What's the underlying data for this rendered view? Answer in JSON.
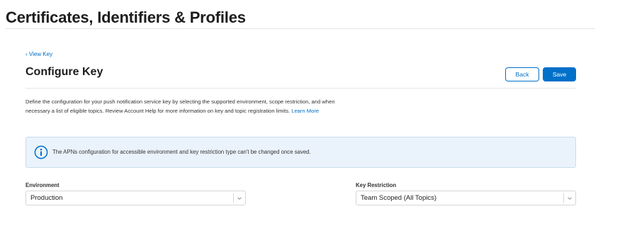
{
  "header": {
    "title": "Certificates, Identifiers & Profiles"
  },
  "nav": {
    "back_link": "‹ View Key"
  },
  "section": {
    "title": "Configure Key",
    "back_button": "Back",
    "save_button": "Save",
    "description": "Define the configuration for your push notification service key by selecting the supported environment, scope restriction, and when necessary a list of eligible topics. Review Account Help for more information on key and topic registration limits.",
    "learn_more": "Learn More"
  },
  "info_notice": {
    "icon": "info-icon",
    "text": "The APNs configuration for accessible environment and key restriction type can't be changed once saved."
  },
  "form": {
    "environment": {
      "label": "Environment",
      "value": "Production"
    },
    "key_restriction": {
      "label": "Key Restriction",
      "value": "Team Scoped (All Topics)"
    }
  },
  "colors": {
    "accent": "#0070c9",
    "info_background": "#eaf3fb",
    "text": "#1d1d1f"
  }
}
